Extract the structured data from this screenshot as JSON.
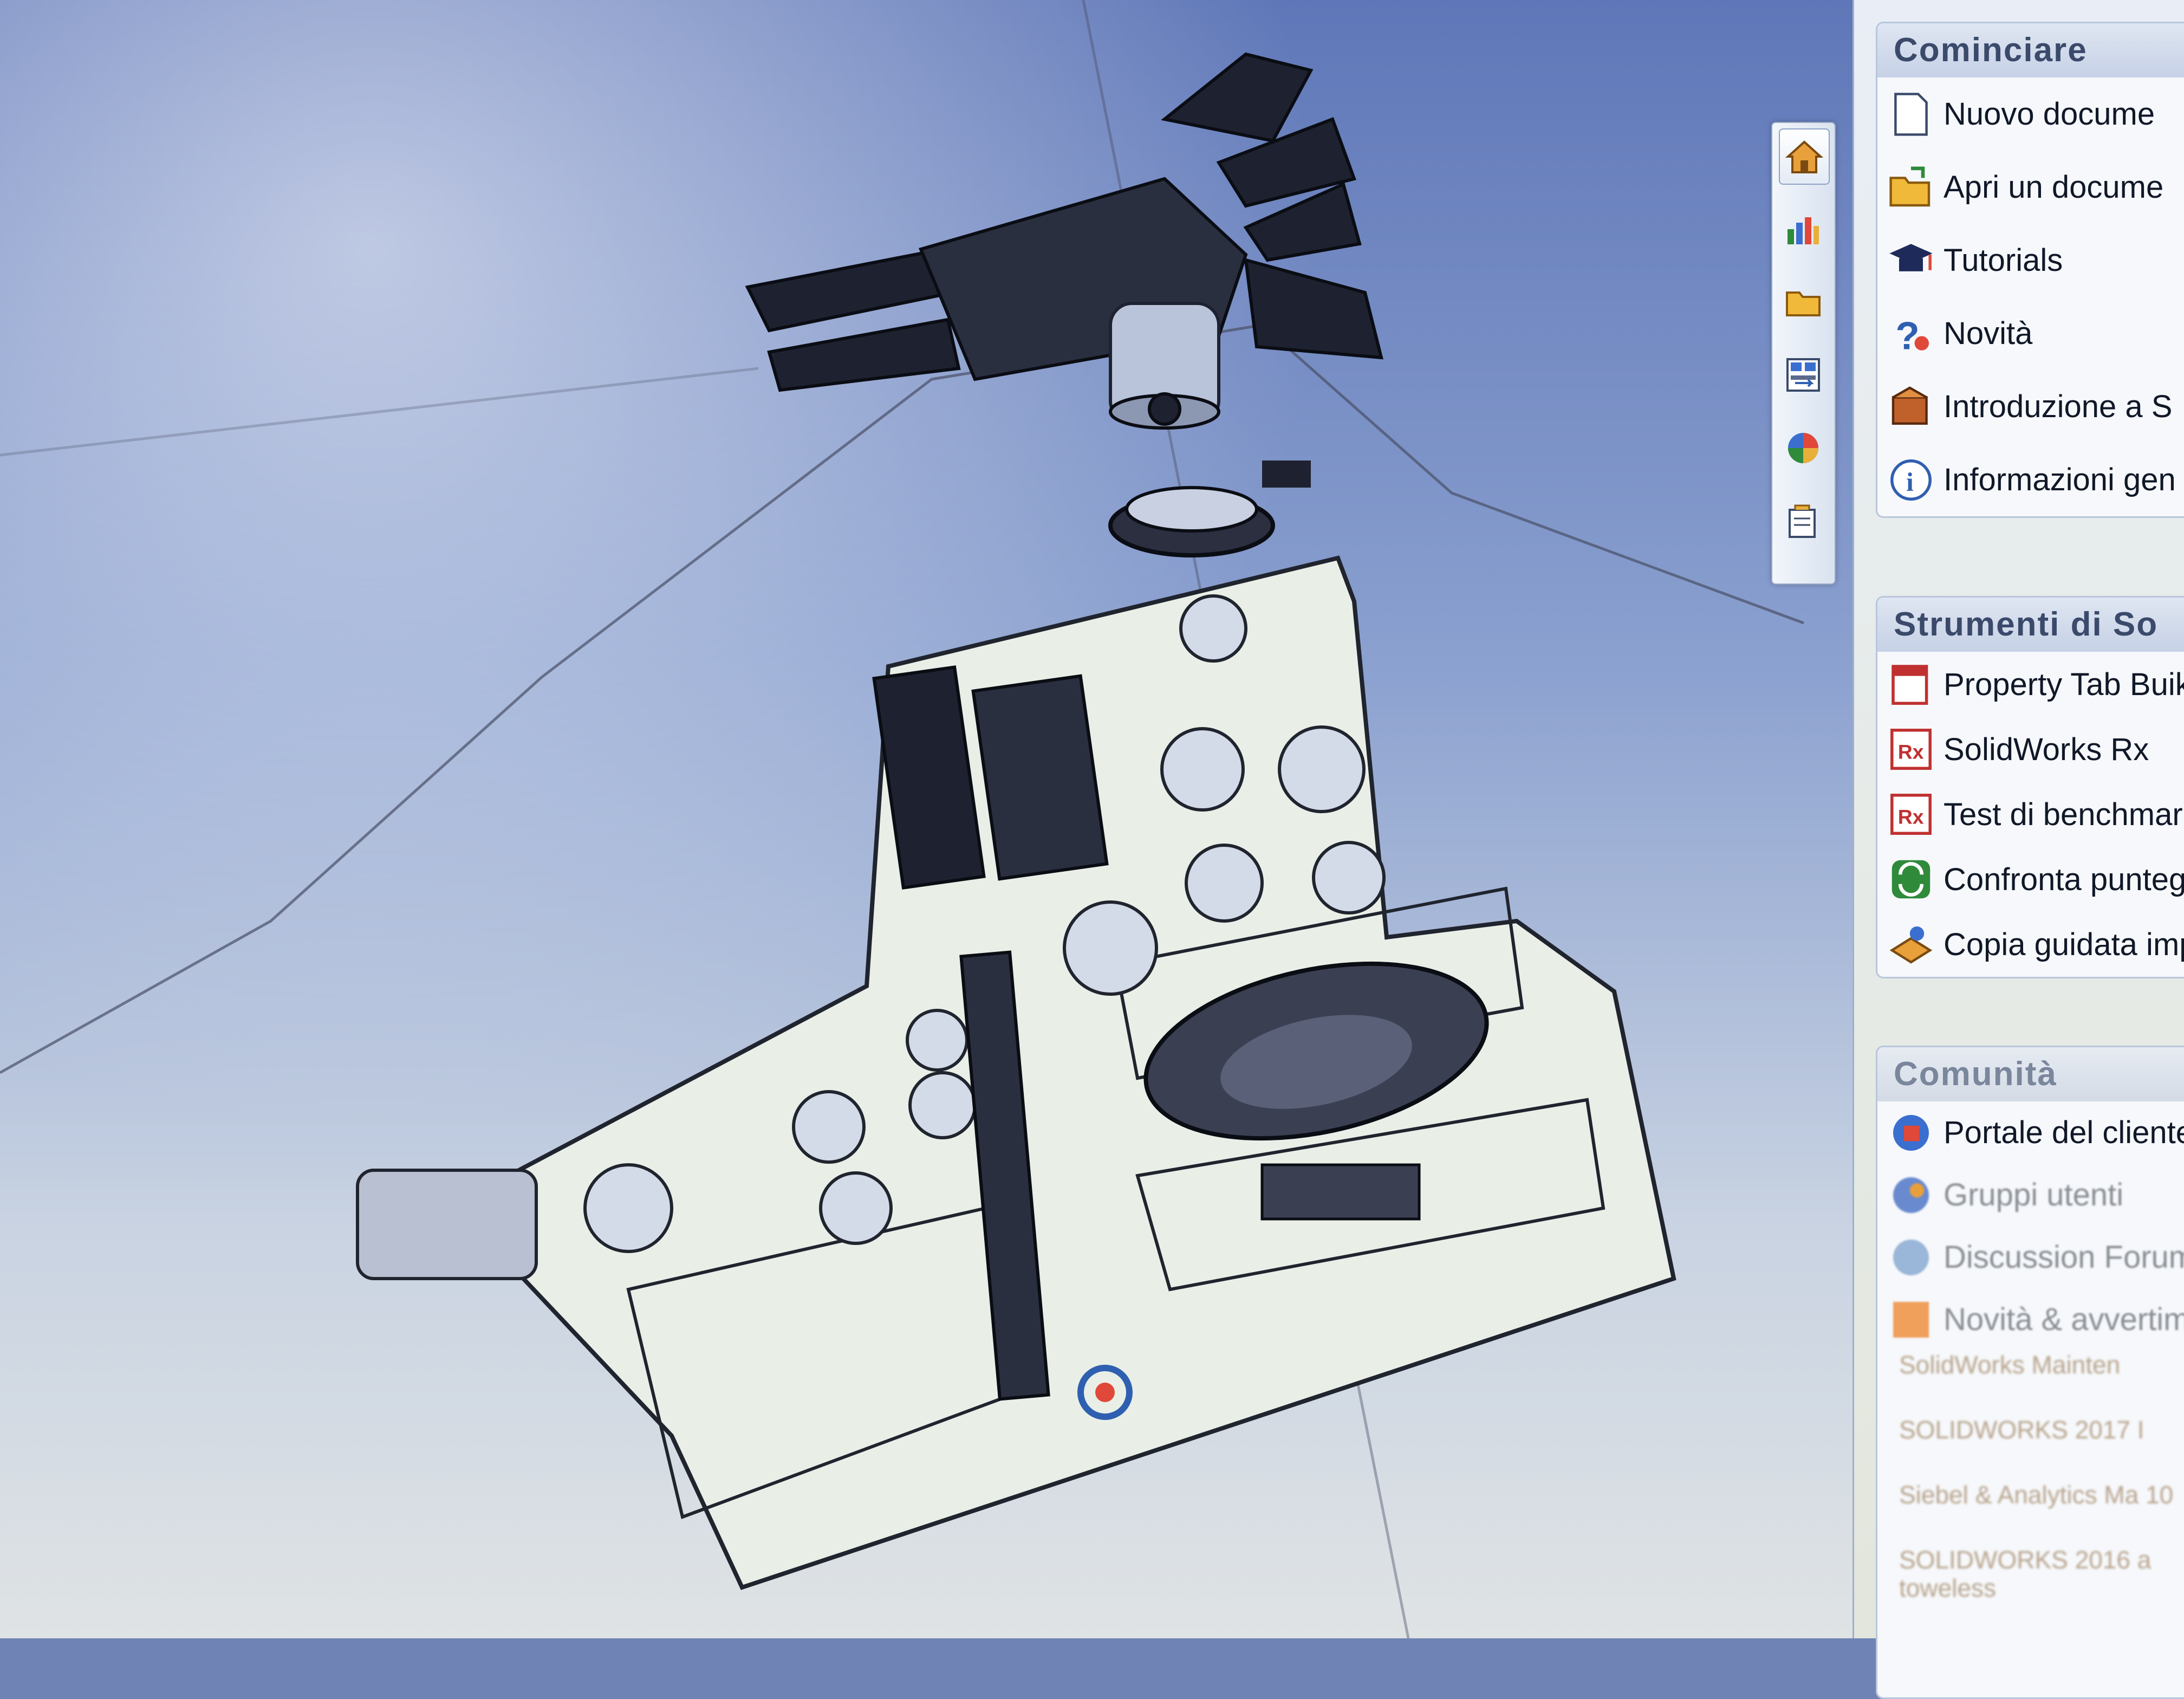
{
  "task_pane": {
    "getting_started": {
      "title": "Cominciare",
      "items": [
        {
          "label": "Nuovo docume",
          "icon": "new-document-icon"
        },
        {
          "label": "Apri un docume",
          "icon": "open-document-icon"
        },
        {
          "label": "Tutorials",
          "icon": "tutorials-icon"
        },
        {
          "label": "Novità",
          "icon": "whats-new-icon"
        },
        {
          "label": "Introduzione a S",
          "icon": "introduction-icon"
        },
        {
          "label": "Informazioni gen",
          "icon": "info-icon"
        }
      ]
    },
    "tools": {
      "title": "Strumenti di So",
      "items": [
        {
          "label": "Property Tab Buik",
          "icon": "property-tab-builder-icon"
        },
        {
          "label": "SolidWorks Rx",
          "icon": "solidworks-rx-icon"
        },
        {
          "label": "Test di benchmark",
          "icon": "benchmark-icon"
        },
        {
          "label": "Confronta puntegg",
          "icon": "compare-scores-icon"
        },
        {
          "label": "Copia guidata impo",
          "icon": "copy-settings-icon"
        }
      ]
    },
    "community": {
      "title": "Comunità",
      "items": [
        {
          "label": "Portale del cliente",
          "icon": "customer-portal-icon"
        },
        {
          "label": "Gruppi utenti",
          "icon": "user-groups-icon"
        },
        {
          "label": "Discussion Forum",
          "icon": "discussion-forum-icon"
        },
        {
          "label": "Novità & avvertimenti",
          "icon": "news-alerts-icon"
        }
      ],
      "sub_items": [
        "SolidWorks Mainten",
        "SOLIDWORKS 2017 I",
        "Siebel & Analytics Ma 10",
        "SOLIDWORKS 2016 a toweless"
      ]
    }
  },
  "tab_strip": {
    "tabs": [
      {
        "icon": "home-icon",
        "active": true
      },
      {
        "icon": "design-library-icon",
        "active": false
      },
      {
        "icon": "file-explorer-icon",
        "active": false
      },
      {
        "icon": "view-palette-icon",
        "active": false
      },
      {
        "icon": "appearances-icon",
        "active": false
      },
      {
        "icon": "custom-properties-icon",
        "active": false
      }
    ]
  },
  "colors": {
    "viewport_top": "#5f77b8",
    "viewport_bottom": "#dfe3e4",
    "plate_fill": "#e9efe7",
    "part_dark": "#1e2230",
    "accent_blue": "#2f5fb0"
  }
}
